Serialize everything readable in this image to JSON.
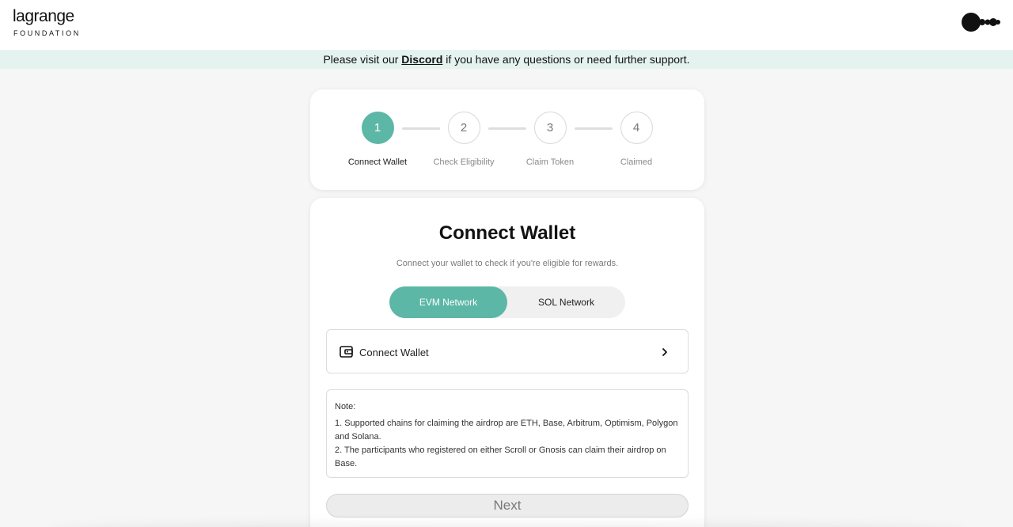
{
  "header": {
    "logo_main": "lagrange",
    "logo_sub": "FOUNDATION",
    "brand_icon": "lagrange-mark-icon"
  },
  "banner": {
    "prefix": "Please visit our ",
    "link": "Discord",
    "suffix": " if you have any questions or need further support."
  },
  "steps": [
    {
      "number": "1",
      "label": "Connect Wallet",
      "active": true
    },
    {
      "number": "2",
      "label": "Check Eligibility",
      "active": false
    },
    {
      "number": "3",
      "label": "Claim Token",
      "active": false
    },
    {
      "number": "4",
      "label": "Claimed",
      "active": false
    }
  ],
  "main": {
    "title": "Connect Wallet",
    "subtitle": "Connect your wallet to check if you're eligible for rewards.",
    "networks": {
      "evm": "EVM Network",
      "sol": "SOL Network",
      "selected": "EVM Network"
    },
    "connect_label": "Connect Wallet",
    "note": {
      "title": "Note:",
      "line1": "1. Supported chains for claiming the airdrop are ETH, Base, Arbitrum, Optimism, Polygon and Solana.",
      "line2": "2. The participants who registered on either Scroll or Gnosis can claim their airdrop on Base."
    },
    "next_label": "Next"
  },
  "colors": {
    "accent": "#5cb7a6",
    "banner_bg": "#e4f3ef"
  }
}
